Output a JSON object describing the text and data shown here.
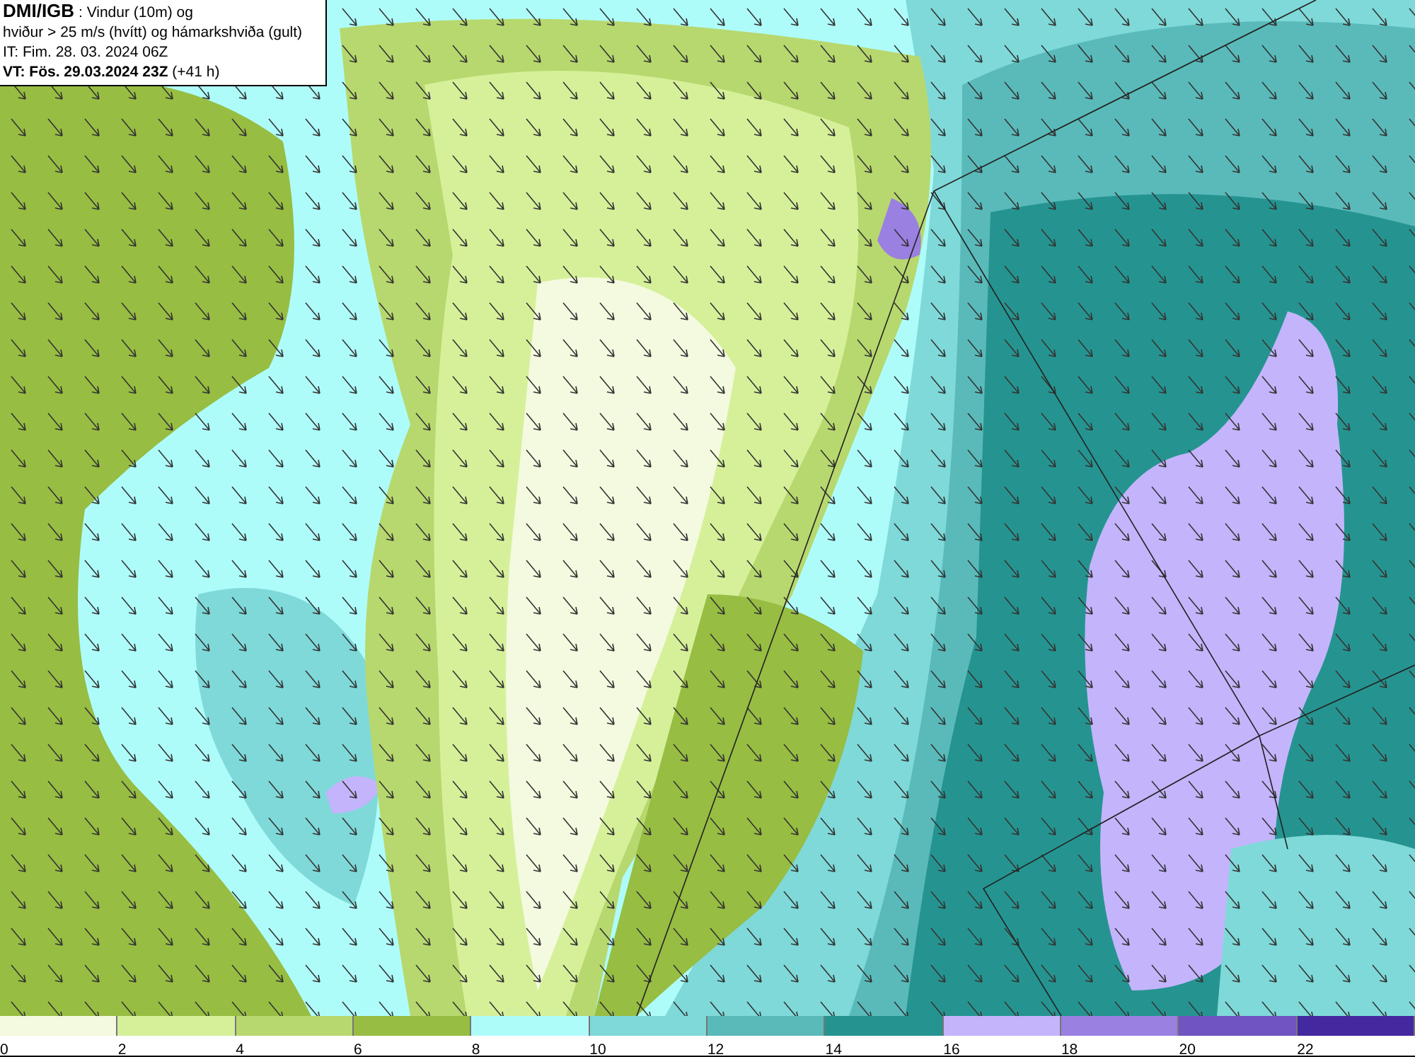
{
  "title_box": {
    "lines": [
      "**DMI/IGB** : Vindur (10m) og",
      "hviður > 25 m/s (hvítt) og hámarkshviða (gult)",
      "IT: Fim. 28. 03. 2024 06Z",
      "**VT: Fös. 29.03.2024 23Z** (+41 h)"
    ]
  },
  "legend": {
    "bins": [
      {
        "label": "0",
        "color": "#f3fadf"
      },
      {
        "label": "2",
        "color": "#d6f09a"
      },
      {
        "label": "4",
        "color": "#b7d86e"
      },
      {
        "label": "6",
        "color": "#97bd42"
      },
      {
        "label": "8",
        "color": "#aefcfa"
      },
      {
        "label": "10",
        "color": "#7fd9d9"
      },
      {
        "label": "12",
        "color": "#5ababa"
      },
      {
        "label": "14",
        "color": "#259490"
      },
      {
        "label": "16",
        "color": "#c4b4fc"
      },
      {
        "label": "18",
        "color": "#9a80e0"
      },
      {
        "label": "20",
        "color": "#7054c0"
      },
      {
        "label": "22",
        "color": "#4428a0"
      }
    ]
  }
}
